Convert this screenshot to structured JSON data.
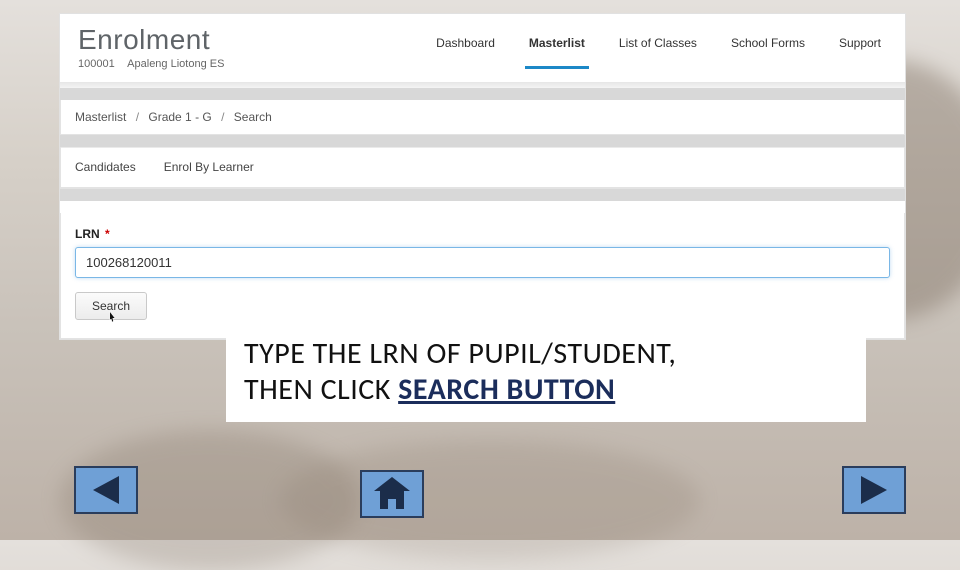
{
  "brand": {
    "title": "Enrolment",
    "school_id": "100001",
    "school_name": "Apaleng Liotong ES"
  },
  "nav": {
    "tabs": [
      {
        "label": "Dashboard",
        "active": false
      },
      {
        "label": "Masterlist",
        "active": true
      },
      {
        "label": "List of Classes",
        "active": false
      },
      {
        "label": "School Forms",
        "active": false
      },
      {
        "label": "Support",
        "active": false
      }
    ]
  },
  "breadcrumb": {
    "items": [
      "Masterlist",
      "Grade 1 - G",
      "Search"
    ],
    "sep": "/"
  },
  "subtabs": {
    "items": [
      {
        "label": "Candidates"
      },
      {
        "label": "Enrol By Learner"
      }
    ]
  },
  "form": {
    "lrn_label": "LRN",
    "required_mark": "*",
    "lrn_value": "100268120011",
    "search_label": "Search"
  },
  "instruction": {
    "line1": "TYPE THE LRN OF PUPIL/STUDENT,",
    "line2_prefix": "THEN CLICK ",
    "line2_bold": "SEARCH BUTTON"
  },
  "slide_nav": {
    "prev": "Previous slide",
    "home": "Home",
    "next": "Next slide"
  }
}
